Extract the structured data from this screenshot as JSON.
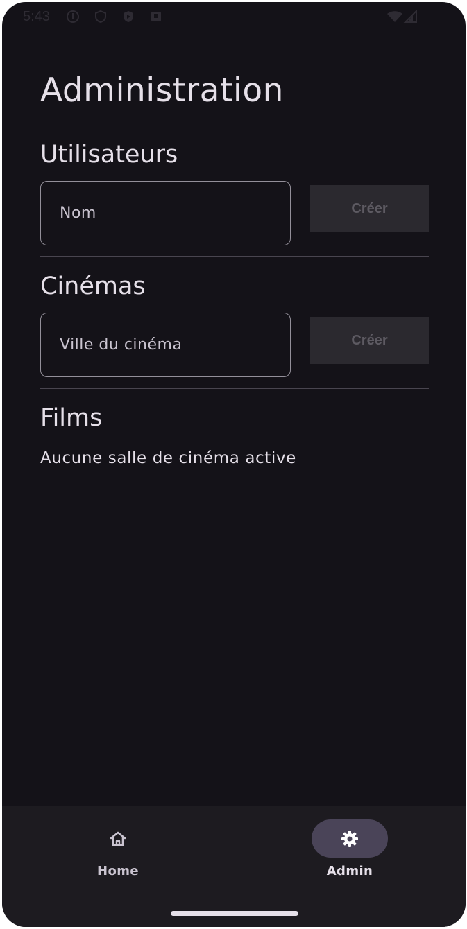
{
  "status_bar": {
    "time": "5:43",
    "icons": [
      "info-icon",
      "shield-icon",
      "play-protect-icon",
      "sd-card-icon"
    ],
    "right_icons": [
      "wifi-icon",
      "signal-icon"
    ]
  },
  "page": {
    "title": "Administration"
  },
  "users_section": {
    "title": "Utilisateurs",
    "name_placeholder": "Nom",
    "create_label": "Créer"
  },
  "cinemas_section": {
    "title": "Cinémas",
    "city_placeholder": "Ville du cinéma",
    "create_label": "Créer"
  },
  "films_section": {
    "title": "Films",
    "empty_message": "Aucune salle de cinéma active"
  },
  "bottom_nav": {
    "items": [
      {
        "label": "Home",
        "icon": "home-icon",
        "active": false
      },
      {
        "label": "Admin",
        "icon": "gear-icon",
        "active": true
      }
    ]
  },
  "colors": {
    "background": "#141218",
    "nav_background": "#1d1b20",
    "nav_active_indicator": "#4a4458",
    "text_primary": "#e6e0e9",
    "outline": "#938f99",
    "button_disabled_bg": "#2b292f",
    "button_disabled_text": "#5d5a62"
  }
}
